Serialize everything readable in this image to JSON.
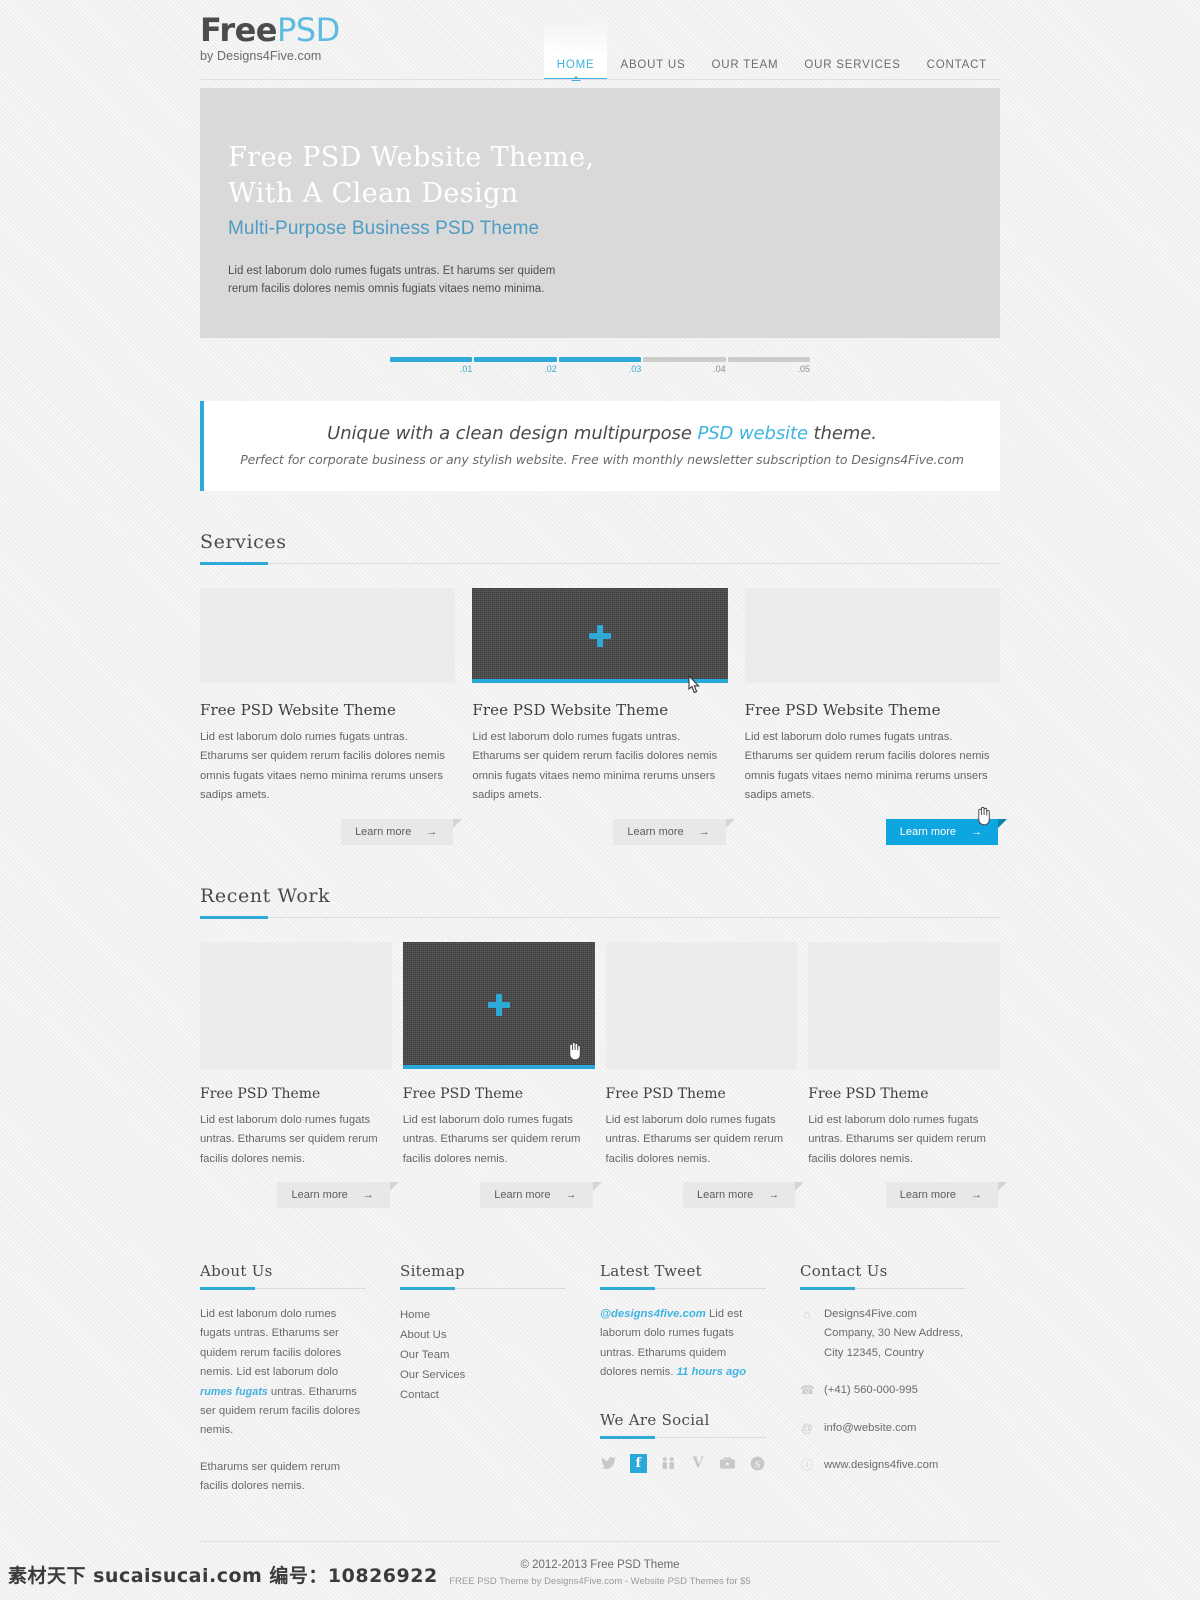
{
  "brand": {
    "logo_first": "Free",
    "logo_second": "PSD",
    "tagline": "by Designs4Five.com"
  },
  "nav": {
    "items": [
      {
        "label": "HOME",
        "active": true
      },
      {
        "label": "ABOUT US",
        "active": false
      },
      {
        "label": "OUR TEAM",
        "active": false
      },
      {
        "label": "OUR SERVICES",
        "active": false
      },
      {
        "label": "CONTACT",
        "active": false
      }
    ]
  },
  "hero": {
    "title_line1": "Free PSD Website Theme,",
    "title_line2": "With A Clean Design",
    "subtitle": "Multi-Purpose Business PSD Theme",
    "body_line1": "Lid est laborum dolo rumes fugats untras. Et harums ser quidem",
    "body_line2": "rerum facilis dolores nemis omnis fugiats vitaes nemo minima."
  },
  "slider": {
    "segments": [
      {
        "label": ".01",
        "active": true
      },
      {
        "label": ".02",
        "active": true
      },
      {
        "label": ".03",
        "active": true
      },
      {
        "label": ".04",
        "active": false
      },
      {
        "label": ".05",
        "active": false
      }
    ]
  },
  "callout": {
    "line1_pre": "Unique with a clean design multipurpose ",
    "line1_em": "PSD website",
    "line1_post": " theme.",
    "line2": "Perfect for corporate business or any stylish website.  Free with monthly newsletter subscription to Designs4Five.com"
  },
  "services": {
    "title": "Services",
    "cards": [
      {
        "title": "Free PSD Website Theme",
        "text": "Lid est laborum dolo rumes fugats untras. Etharums ser quidem rerum facilis dolores nemis omnis fugats vitaes nemo minima rerums unsers sadips amets.",
        "button": "Learn more",
        "arrow": "→",
        "hovered": false,
        "button_primary": false
      },
      {
        "title": "Free PSD Website Theme",
        "text": "Lid est laborum dolo rumes fugats untras. Etharums ser quidem rerum facilis dolores nemis omnis fugats vitaes nemo minima rerums unsers sadips amets.",
        "button": "Learn more",
        "arrow": "→",
        "hovered": true,
        "button_primary": false
      },
      {
        "title": "Free PSD Website Theme",
        "text": "Lid est laborum dolo rumes fugats untras. Etharums ser quidem rerum facilis dolores nemis omnis fugats vitaes nemo minima rerums unsers sadips amets.",
        "button": "Learn more",
        "arrow": "→",
        "hovered": false,
        "button_primary": true
      }
    ]
  },
  "recent_work": {
    "title": "Recent Work",
    "cards": [
      {
        "title": "Free PSD Theme",
        "text": "Lid est laborum dolo rumes fugats untras. Etharums ser quidem rerum facilis dolores nemis.",
        "button": "Learn more",
        "arrow": "→",
        "hovered": false
      },
      {
        "title": "Free PSD Theme",
        "text": "Lid est laborum dolo rumes fugats untras. Etharums ser quidem rerum facilis dolores nemis.",
        "button": "Learn more",
        "arrow": "→",
        "hovered": true
      },
      {
        "title": "Free PSD Theme",
        "text": "Lid est laborum dolo rumes fugats untras. Etharums ser quidem rerum facilis dolores nemis.",
        "button": "Learn more",
        "arrow": "→",
        "hovered": false
      },
      {
        "title": "Free PSD Theme",
        "text": "Lid est laborum dolo rumes fugats untras. Etharums ser quidem rerum facilis dolores nemis.",
        "button": "Learn more",
        "arrow": "→",
        "hovered": false
      }
    ]
  },
  "footer": {
    "about": {
      "title": "About Us",
      "p1_pre": "Lid est laborum dolo rumes fugats untras. Etharums ser quidem rerum facilis dolores nemis. Lid est laborum dolo ",
      "p1_em": "rumes fugats",
      "p1_post": " untras. Etharums ser quidem rerum facilis dolores nemis.",
      "p2": "Etharums ser quidem rerum facilis dolores nemis."
    },
    "sitemap": {
      "title": "Sitemap",
      "links": [
        "Home",
        "About Us",
        "Our Team",
        "Our Services",
        "Contact"
      ]
    },
    "tweet": {
      "title": "Latest Tweet",
      "handle": "@designs4five.com",
      "body": " Lid est laborum dolo rumes fugats untras. Etharums quidem dolores nemis. ",
      "time": "11 hours ago"
    },
    "social": {
      "title": "We Are Social",
      "icons": [
        {
          "name": "twitter-icon",
          "glyph": "🐦",
          "active": false
        },
        {
          "name": "facebook-icon",
          "glyph": "f",
          "active": true
        },
        {
          "name": "dribbble-icon",
          "glyph": "὆b",
          "active": false
        },
        {
          "name": "vimeo-icon",
          "glyph": "V",
          "active": false
        },
        {
          "name": "youtube-icon",
          "glyph": "▭",
          "active": false
        },
        {
          "name": "skype-icon",
          "glyph": "S",
          "active": false
        }
      ]
    },
    "contact": {
      "title": "Contact Us",
      "rows": [
        {
          "icon": "home-icon",
          "glyph": "⌂",
          "text": "Designs4Five.com Company, 30 New Address, City 12345, Country"
        },
        {
          "icon": "phone-icon",
          "glyph": "☎",
          "text": "(+41) 560-000-995"
        },
        {
          "icon": "email-icon",
          "glyph": "@",
          "text": "info@website.com"
        },
        {
          "icon": "globe-icon",
          "glyph": "ⓘ",
          "text": "www.designs4five.com"
        }
      ]
    },
    "bottom_line1": "© 2012-2013 Free PSD Theme",
    "bottom_line2": "FREE PSD Theme by Designs4Five.com - Website PSD Themes for $5"
  },
  "watermark": "素材天下 sucaisucai.com 编号：10826922",
  "colors": {
    "accent": "#2ea9d8",
    "accent_light": "#3fb4e3",
    "button_primary": "#0ea6e0"
  }
}
